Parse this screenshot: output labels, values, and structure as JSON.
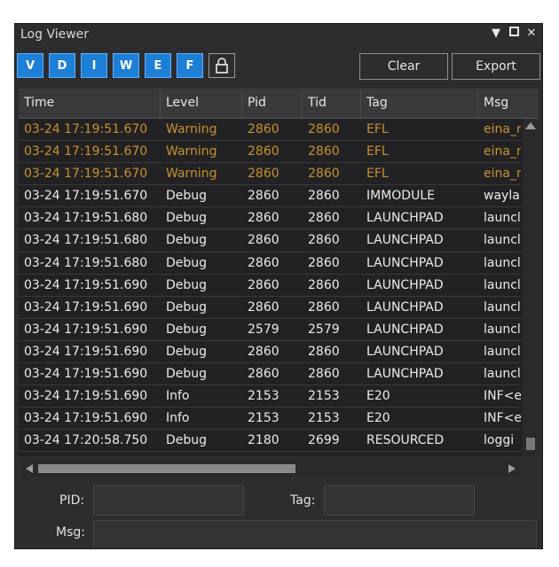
{
  "window": {
    "title": "Log Viewer",
    "controls": [
      "dropdown-icon",
      "maximize-icon",
      "close-icon"
    ]
  },
  "toolbar": {
    "level_buttons": [
      "V",
      "D",
      "I",
      "W",
      "E",
      "F"
    ],
    "lock_icon": "lock-icon",
    "clear_label": "Clear",
    "export_label": "Export"
  },
  "table": {
    "columns": [
      "Time",
      "Level",
      "Pid",
      "Tid",
      "Tag",
      "Msg"
    ],
    "rows": [
      {
        "time": "03-24 17:19:51.670",
        "level": "Warning",
        "pid": "2860",
        "tid": "2860",
        "tag": "EFL",
        "msg": "eina_r"
      },
      {
        "time": "03-24 17:19:51.670",
        "level": "Warning",
        "pid": "2860",
        "tid": "2860",
        "tag": "EFL",
        "msg": "eina_r"
      },
      {
        "time": "03-24 17:19:51.670",
        "level": "Warning",
        "pid": "2860",
        "tid": "2860",
        "tag": "EFL",
        "msg": "eina_r"
      },
      {
        "time": "03-24 17:19:51.670",
        "level": "Debug",
        "pid": "2860",
        "tid": "2860",
        "tag": "IMMODULE",
        "msg": "wayla"
      },
      {
        "time": "03-24 17:19:51.680",
        "level": "Debug",
        "pid": "2860",
        "tid": "2860",
        "tag": "LAUNCHPAD",
        "msg": "launcl"
      },
      {
        "time": "03-24 17:19:51.680",
        "level": "Debug",
        "pid": "2860",
        "tid": "2860",
        "tag": "LAUNCHPAD",
        "msg": "launcl"
      },
      {
        "time": "03-24 17:19:51.680",
        "level": "Debug",
        "pid": "2860",
        "tid": "2860",
        "tag": "LAUNCHPAD",
        "msg": "launcl"
      },
      {
        "time": "03-24 17:19:51.690",
        "level": "Debug",
        "pid": "2860",
        "tid": "2860",
        "tag": "LAUNCHPAD",
        "msg": "launcl"
      },
      {
        "time": "03-24 17:19:51.690",
        "level": "Debug",
        "pid": "2860",
        "tid": "2860",
        "tag": "LAUNCHPAD",
        "msg": "launcl"
      },
      {
        "time": "03-24 17:19:51.690",
        "level": "Debug",
        "pid": "2579",
        "tid": "2579",
        "tag": "LAUNCHPAD",
        "msg": "launcl"
      },
      {
        "time": "03-24 17:19:51.690",
        "level": "Debug",
        "pid": "2860",
        "tid": "2860",
        "tag": "LAUNCHPAD",
        "msg": "launcl"
      },
      {
        "time": "03-24 17:19:51.690",
        "level": "Debug",
        "pid": "2860",
        "tid": "2860",
        "tag": "LAUNCHPAD",
        "msg": "launcl"
      },
      {
        "time": "03-24 17:19:51.690",
        "level": "Info",
        "pid": "2153",
        "tid": "2153",
        "tag": "E20",
        "msg": "INF<e"
      },
      {
        "time": "03-24 17:19:51.690",
        "level": "Info",
        "pid": "2153",
        "tid": "2153",
        "tag": "E20",
        "msg": "INF<e"
      },
      {
        "time": "03-24 17:20:58.750",
        "level": "Debug",
        "pid": "2180",
        "tid": "2699",
        "tag": "RESOURCED",
        "msg": "loggi"
      }
    ]
  },
  "filters": {
    "pid_label": "PID:",
    "tag_label": "Tag:",
    "msg_label": "Msg:"
  },
  "colors": {
    "warning_text": "#c8902c",
    "normal_text": "#ebebeb",
    "level_button_bg": "#1e7fd6",
    "panel_bg": "#2d2d30"
  }
}
